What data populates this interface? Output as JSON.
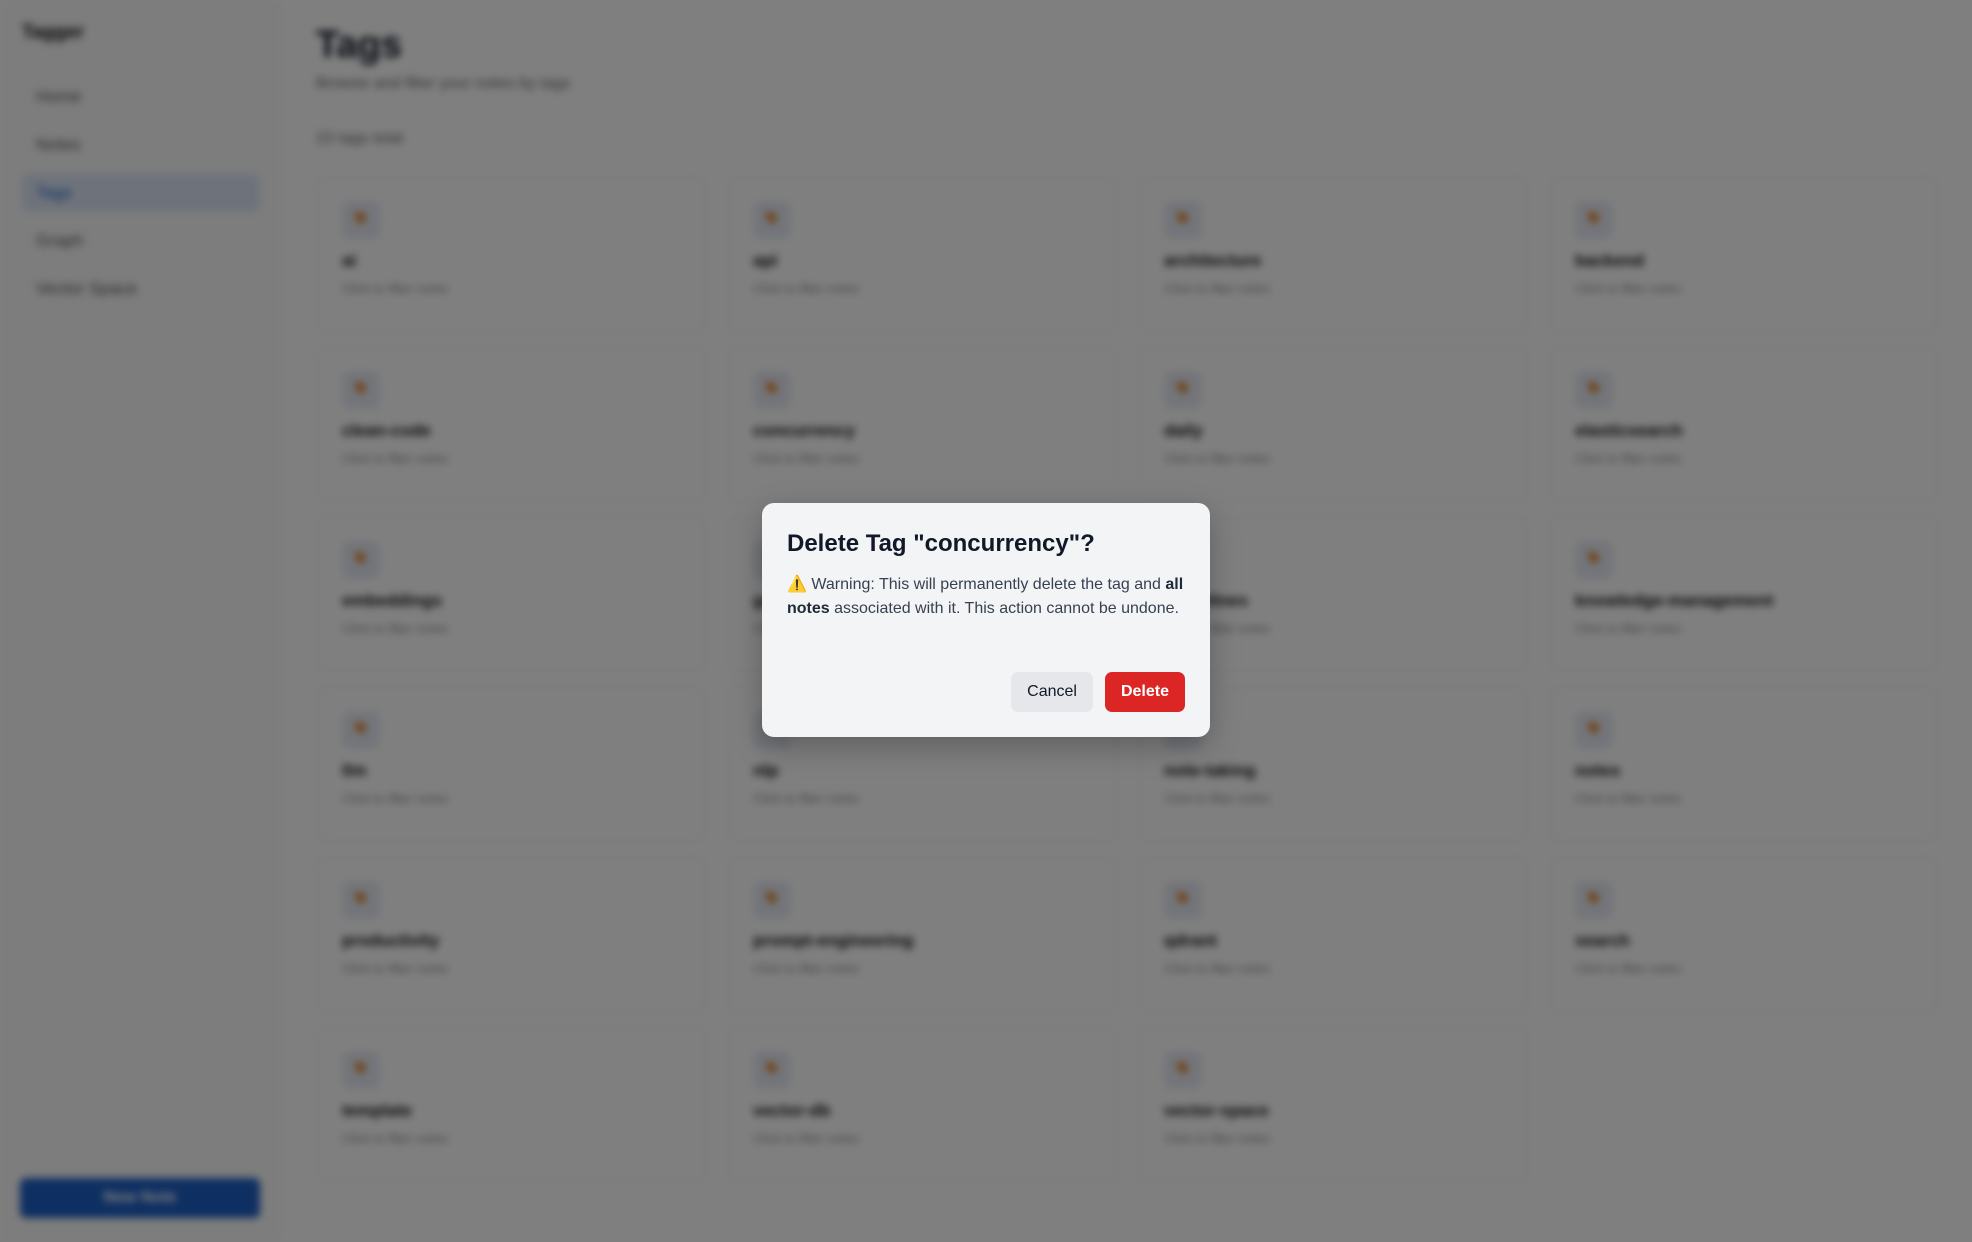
{
  "app": {
    "name": "Tagger"
  },
  "sidebar": {
    "items": [
      {
        "label": "Home"
      },
      {
        "label": "Notes"
      },
      {
        "label": "Tags"
      },
      {
        "label": "Graph"
      },
      {
        "label": "Vector Space"
      }
    ],
    "new_note_label": "New Note"
  },
  "page": {
    "title": "Tags",
    "subtitle": "Browse and filter your notes by tags",
    "count": "23 tags total"
  },
  "tag_hint": "Click to filter notes",
  "tag_icon": "tag-icon",
  "tags": [
    {
      "name": "ai"
    },
    {
      "name": "api"
    },
    {
      "name": "architecture"
    },
    {
      "name": "backend"
    },
    {
      "name": "clean-code"
    },
    {
      "name": "concurrency"
    },
    {
      "name": "daily"
    },
    {
      "name": "elasticsearch"
    },
    {
      "name": "embeddings"
    },
    {
      "name": "golang"
    },
    {
      "name": "guidelines"
    },
    {
      "name": "knowledge-management"
    },
    {
      "name": "llm"
    },
    {
      "name": "nlp"
    },
    {
      "name": "note-taking"
    },
    {
      "name": "notes"
    },
    {
      "name": "productivity"
    },
    {
      "name": "prompt-engineering"
    },
    {
      "name": "qdrant"
    },
    {
      "name": "search"
    },
    {
      "name": "template"
    },
    {
      "name": "vector-db"
    },
    {
      "name": "vector-space"
    }
  ],
  "dialog": {
    "title": "Delete Tag \"concurrency\"?",
    "warning_icon": "⚠️",
    "warning_pre": "Warning: This will permanently delete the tag and ",
    "warning_bold": "all notes",
    "warning_post": " associated with it. This action cannot be undone.",
    "cancel_label": "Cancel",
    "delete_label": "Delete"
  },
  "colors": {
    "accent": "#1d5fc4",
    "danger": "#dc2626",
    "tag_icon": "#e07b1a"
  }
}
